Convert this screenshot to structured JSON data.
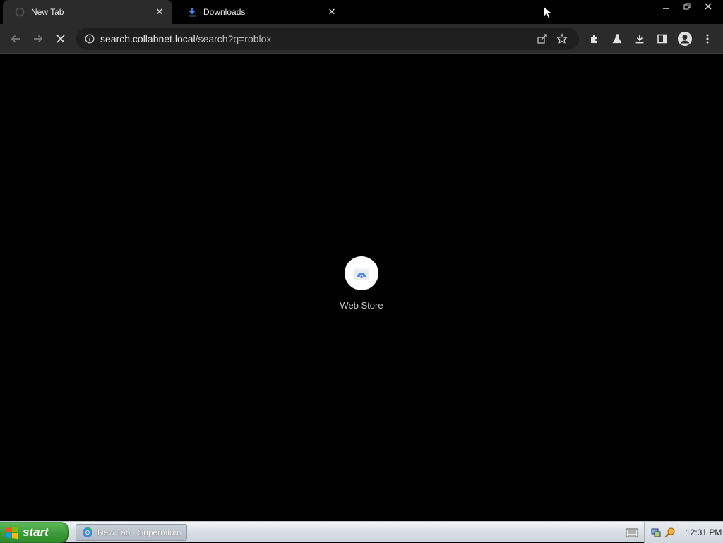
{
  "browser": {
    "tabs": [
      {
        "title": "New Tab",
        "active": true
      },
      {
        "title": "Downloads",
        "active": false
      }
    ],
    "toolbar": {
      "url_host": "search.collabnet.local",
      "url_path": "/search?q=roblox"
    }
  },
  "content": {
    "shortcut_label": "Web Store"
  },
  "taskbar": {
    "start_label": "start",
    "task_item_label": "New Tab - Supermium",
    "clock": "12:31 PM"
  },
  "colors": {
    "accent": "#4285f4",
    "start_green": "#3c9b38"
  }
}
